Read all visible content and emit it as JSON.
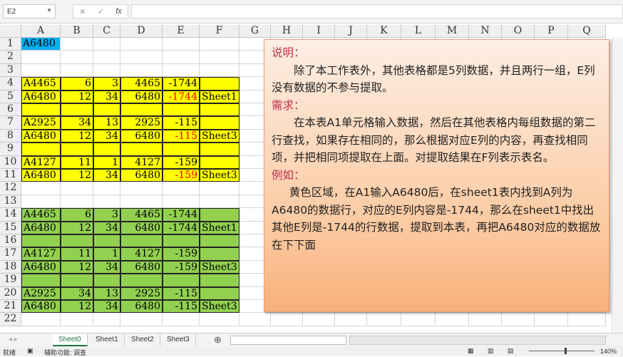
{
  "formula_bar": {
    "name_box": "E2",
    "cancel_icon": "✕",
    "enter_icon": "✓",
    "fx_label": "fx",
    "formula": ""
  },
  "columns": [
    "A",
    "B",
    "C",
    "D",
    "E",
    "F",
    "G",
    "H",
    "I",
    "J",
    "K",
    "L",
    "M",
    "N",
    "O",
    "P",
    "Q"
  ],
  "colors": {
    "yellow": "#ffff00",
    "green": "#92d050",
    "blue": "#00b0f0",
    "red_text": "#ff0000",
    "heading": "#c0304a"
  },
  "rows": [
    {
      "n": "1",
      "cells": [
        "A6480",
        "",
        "",
        "",
        "",
        ""
      ],
      "fill": "a1"
    },
    {
      "n": "2",
      "cells": [
        "",
        "",
        "",
        "",
        "",
        ""
      ]
    },
    {
      "n": "3",
      "cells": [
        "",
        "",
        "",
        "",
        "",
        ""
      ]
    },
    {
      "n": "4",
      "cells": [
        "A4465",
        "6",
        "3",
        "4465",
        "-1744",
        ""
      ],
      "fill": "yellow"
    },
    {
      "n": "5",
      "cells": [
        "A6480",
        "12",
        "34",
        "6480",
        "-1744",
        "Sheet1"
      ],
      "fill": "yellow",
      "red_e": true
    },
    {
      "n": "6",
      "cells": [
        "",
        "",
        "",
        "",
        "",
        ""
      ],
      "fill": "yellow"
    },
    {
      "n": "7",
      "cells": [
        "A2925",
        "34",
        "13",
        "2925",
        "-115",
        ""
      ],
      "fill": "yellow"
    },
    {
      "n": "8",
      "cells": [
        "A6480",
        "12",
        "34",
        "6480",
        "-115",
        "Sheet3"
      ],
      "fill": "yellow",
      "red_e": true
    },
    {
      "n": "9",
      "cells": [
        "",
        "",
        "",
        "",
        "",
        ""
      ],
      "fill": "yellow"
    },
    {
      "n": "10",
      "cells": [
        "A4127",
        "11",
        "1",
        "4127",
        "-159",
        ""
      ],
      "fill": "yellow"
    },
    {
      "n": "11",
      "cells": [
        "A6480",
        "12",
        "34",
        "6480",
        "-159",
        "Sheet3"
      ],
      "fill": "yellow",
      "red_e": true
    },
    {
      "n": "12",
      "cells": [
        "",
        "",
        "",
        "",
        "",
        ""
      ]
    },
    {
      "n": "13",
      "cells": [
        "",
        "",
        "",
        "",
        "",
        ""
      ]
    },
    {
      "n": "14",
      "cells": [
        "A4465",
        "6",
        "3",
        "4465",
        "-1744",
        ""
      ],
      "fill": "green"
    },
    {
      "n": "15",
      "cells": [
        "A6480",
        "12",
        "34",
        "6480",
        "-1744",
        "Sheet1"
      ],
      "fill": "green"
    },
    {
      "n": "16",
      "cells": [
        "",
        "",
        "",
        "",
        "",
        ""
      ],
      "fill": "green"
    },
    {
      "n": "17",
      "cells": [
        "A4127",
        "11",
        "1",
        "4127",
        "-159",
        ""
      ],
      "fill": "green"
    },
    {
      "n": "18",
      "cells": [
        "A6480",
        "12",
        "34",
        "6480",
        "-159",
        "Sheet3"
      ],
      "fill": "green"
    },
    {
      "n": "19",
      "cells": [
        "",
        "",
        "",
        "",
        "",
        ""
      ],
      "fill": "green"
    },
    {
      "n": "20",
      "cells": [
        "A2925",
        "34",
        "13",
        "2925",
        "-115",
        ""
      ],
      "fill": "green"
    },
    {
      "n": "21",
      "cells": [
        "A6480",
        "12",
        "34",
        "6480",
        "-115",
        "Sheet3"
      ],
      "fill": "green"
    },
    {
      "n": "22",
      "cells": [
        "",
        "",
        "",
        "",
        "",
        ""
      ]
    }
  ],
  "note": {
    "h1": "说明：",
    "p1": "除了本工作表外，其他表格都是5列数据，并且两行一组，E列没有数据的不参与提取。",
    "h2": "需求：",
    "p2": "在本表A1单元格输入数据，然后在其他表格内每组数据的第二行查找，如果存在相同的，那么根据对应E列的内容，再查找相同项，并把相同项提取在上面。对提取结果在F列表示表名。",
    "h3": "例如：",
    "p3": "黄色区域，在A1输入A6480后，在sheet1表内找到A列为A6480的数据行，对应的E列内容是-1744，那么在sheet1中找出其他E列是-1744的行数据，提取到本表，再把A6480对应的数据放在下下面"
  },
  "tabs": [
    "Sheet0",
    "Sheet1",
    "Sheet2",
    "Sheet3"
  ],
  "add_sheet": "⊕",
  "status": {
    "ready": "就绪",
    "accessibility": "辅助功能: 调查",
    "zoom": "140%"
  }
}
